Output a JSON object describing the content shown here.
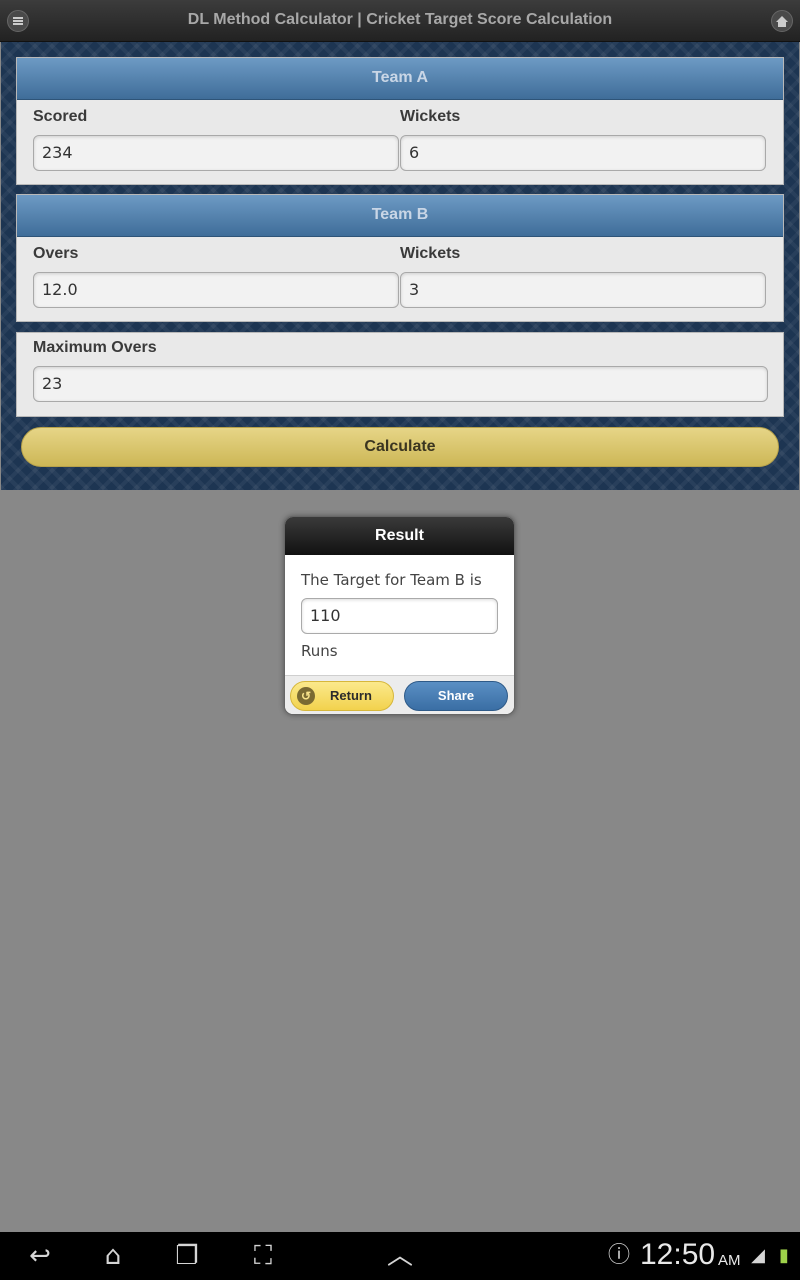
{
  "header": {
    "title": "DL Method Calculator | Cricket Target Score Calculation",
    "menu_icon": "menu-icon",
    "home_icon": "home-icon"
  },
  "team_a": {
    "heading": "Team A",
    "scored_label": "Scored",
    "scored_value": "234",
    "wickets_label": "Wickets",
    "wickets_value": "6"
  },
  "team_b": {
    "heading": "Team B",
    "overs_label": "Overs",
    "overs_value": "12.0",
    "wickets_label": "Wickets",
    "wickets_value": "3"
  },
  "max_overs": {
    "label": "Maximum Overs",
    "value": "23"
  },
  "calculate_label": "Calculate",
  "dialog": {
    "title": "Result",
    "line1": "The Target for Team B is",
    "target_value": "110",
    "line2": "Runs",
    "return_label": "Return",
    "share_label": "Share"
  },
  "statusbar": {
    "time": "12:50",
    "ampm": "AM"
  },
  "colors": {
    "header_bg": "#2b2b2b",
    "panel_head": "#4f7fae",
    "calculate": "#dcc86d",
    "overlay": "#888888"
  }
}
